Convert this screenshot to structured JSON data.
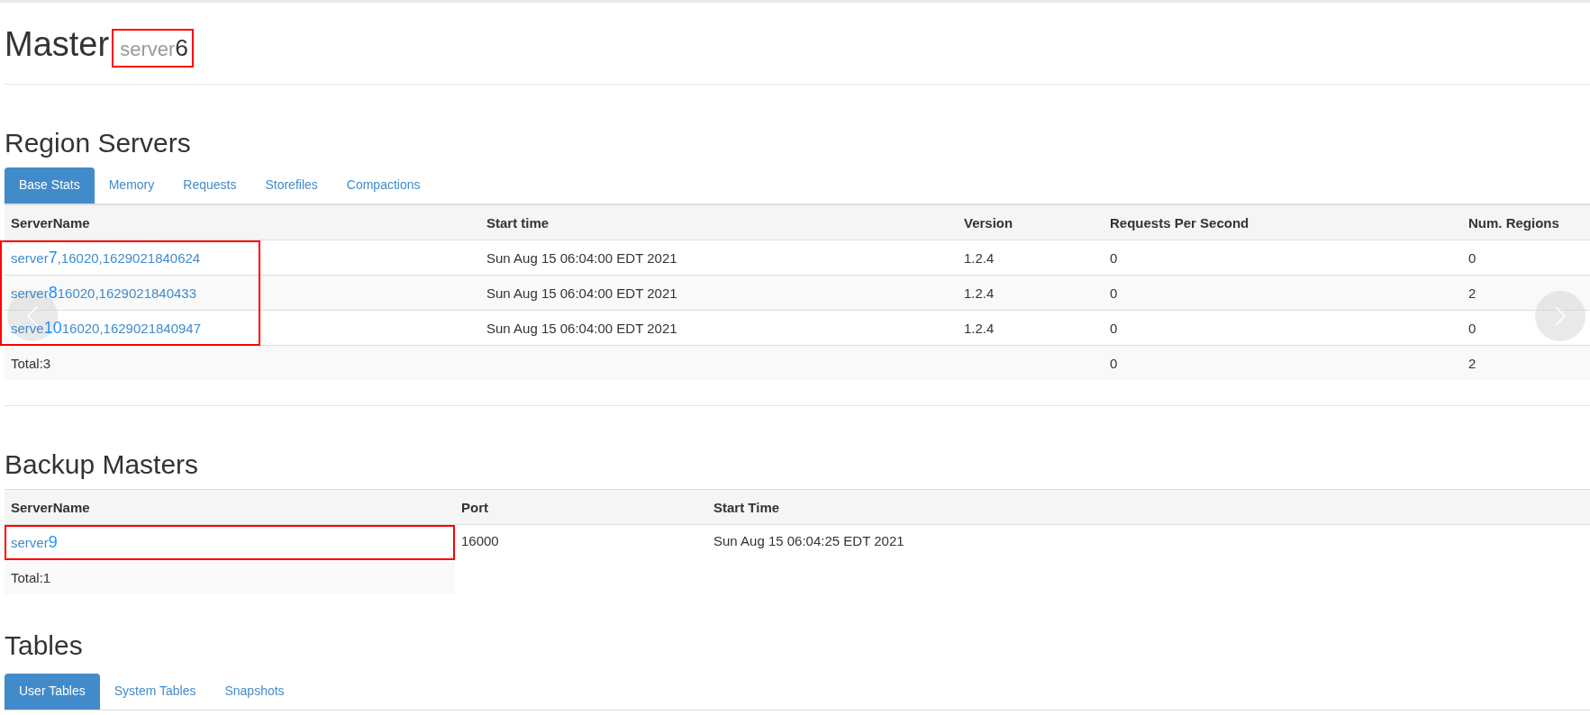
{
  "master": {
    "title": "Master",
    "server": {
      "prefix": "server",
      "mark": "6"
    },
    "highlighted": true
  },
  "region_servers": {
    "title": "Region Servers",
    "tabs": [
      {
        "label": "Base Stats",
        "selected": true
      },
      {
        "label": "Memory",
        "selected": false
      },
      {
        "label": "Requests",
        "selected": false
      },
      {
        "label": "Storefiles",
        "selected": false
      },
      {
        "label": "Compactions",
        "selected": false
      }
    ],
    "columns": [
      "ServerName",
      "Start time",
      "Version",
      "Requests Per Second",
      "Num. Regions"
    ],
    "rows": [
      {
        "server": {
          "prefix": "server",
          "mark": "7",
          "suffix": ",16020,1629021840624"
        },
        "start_time": "Sun Aug 15 06:04:00 EDT 2021",
        "version": "1.2.4",
        "requests": "0",
        "regions": "0"
      },
      {
        "server": {
          "prefix": "server",
          "mark": "8",
          "suffix": "16020,1629021840433"
        },
        "start_time": "Sun Aug 15 06:04:00 EDT 2021",
        "version": "1.2.4",
        "requests": "0",
        "regions": "2"
      },
      {
        "server": {
          "prefix": "serve",
          "mark": "10",
          "suffix": "16020,1629021840947"
        },
        "start_time": "Sun Aug 15 06:04:00 EDT 2021",
        "version": "1.2.4",
        "requests": "0",
        "regions": "0"
      }
    ],
    "highlighted": true,
    "total": {
      "label": "Total:3",
      "requests": "0",
      "regions": "2"
    }
  },
  "backup_masters": {
    "title": "Backup Masters",
    "columns": [
      "ServerName",
      "Port",
      "Start Time"
    ],
    "rows": [
      {
        "server": {
          "prefix": "server",
          "mark": "9"
        },
        "port": "16000",
        "start_time": "Sun Aug 15 06:04:25 EDT 2021",
        "highlighted": true
      }
    ],
    "total": "Total:1"
  },
  "tables": {
    "title": "Tables",
    "tabs": [
      {
        "label": "User Tables",
        "selected": true
      },
      {
        "label": "System Tables",
        "selected": false
      },
      {
        "label": "Snapshots",
        "selected": false
      }
    ]
  }
}
